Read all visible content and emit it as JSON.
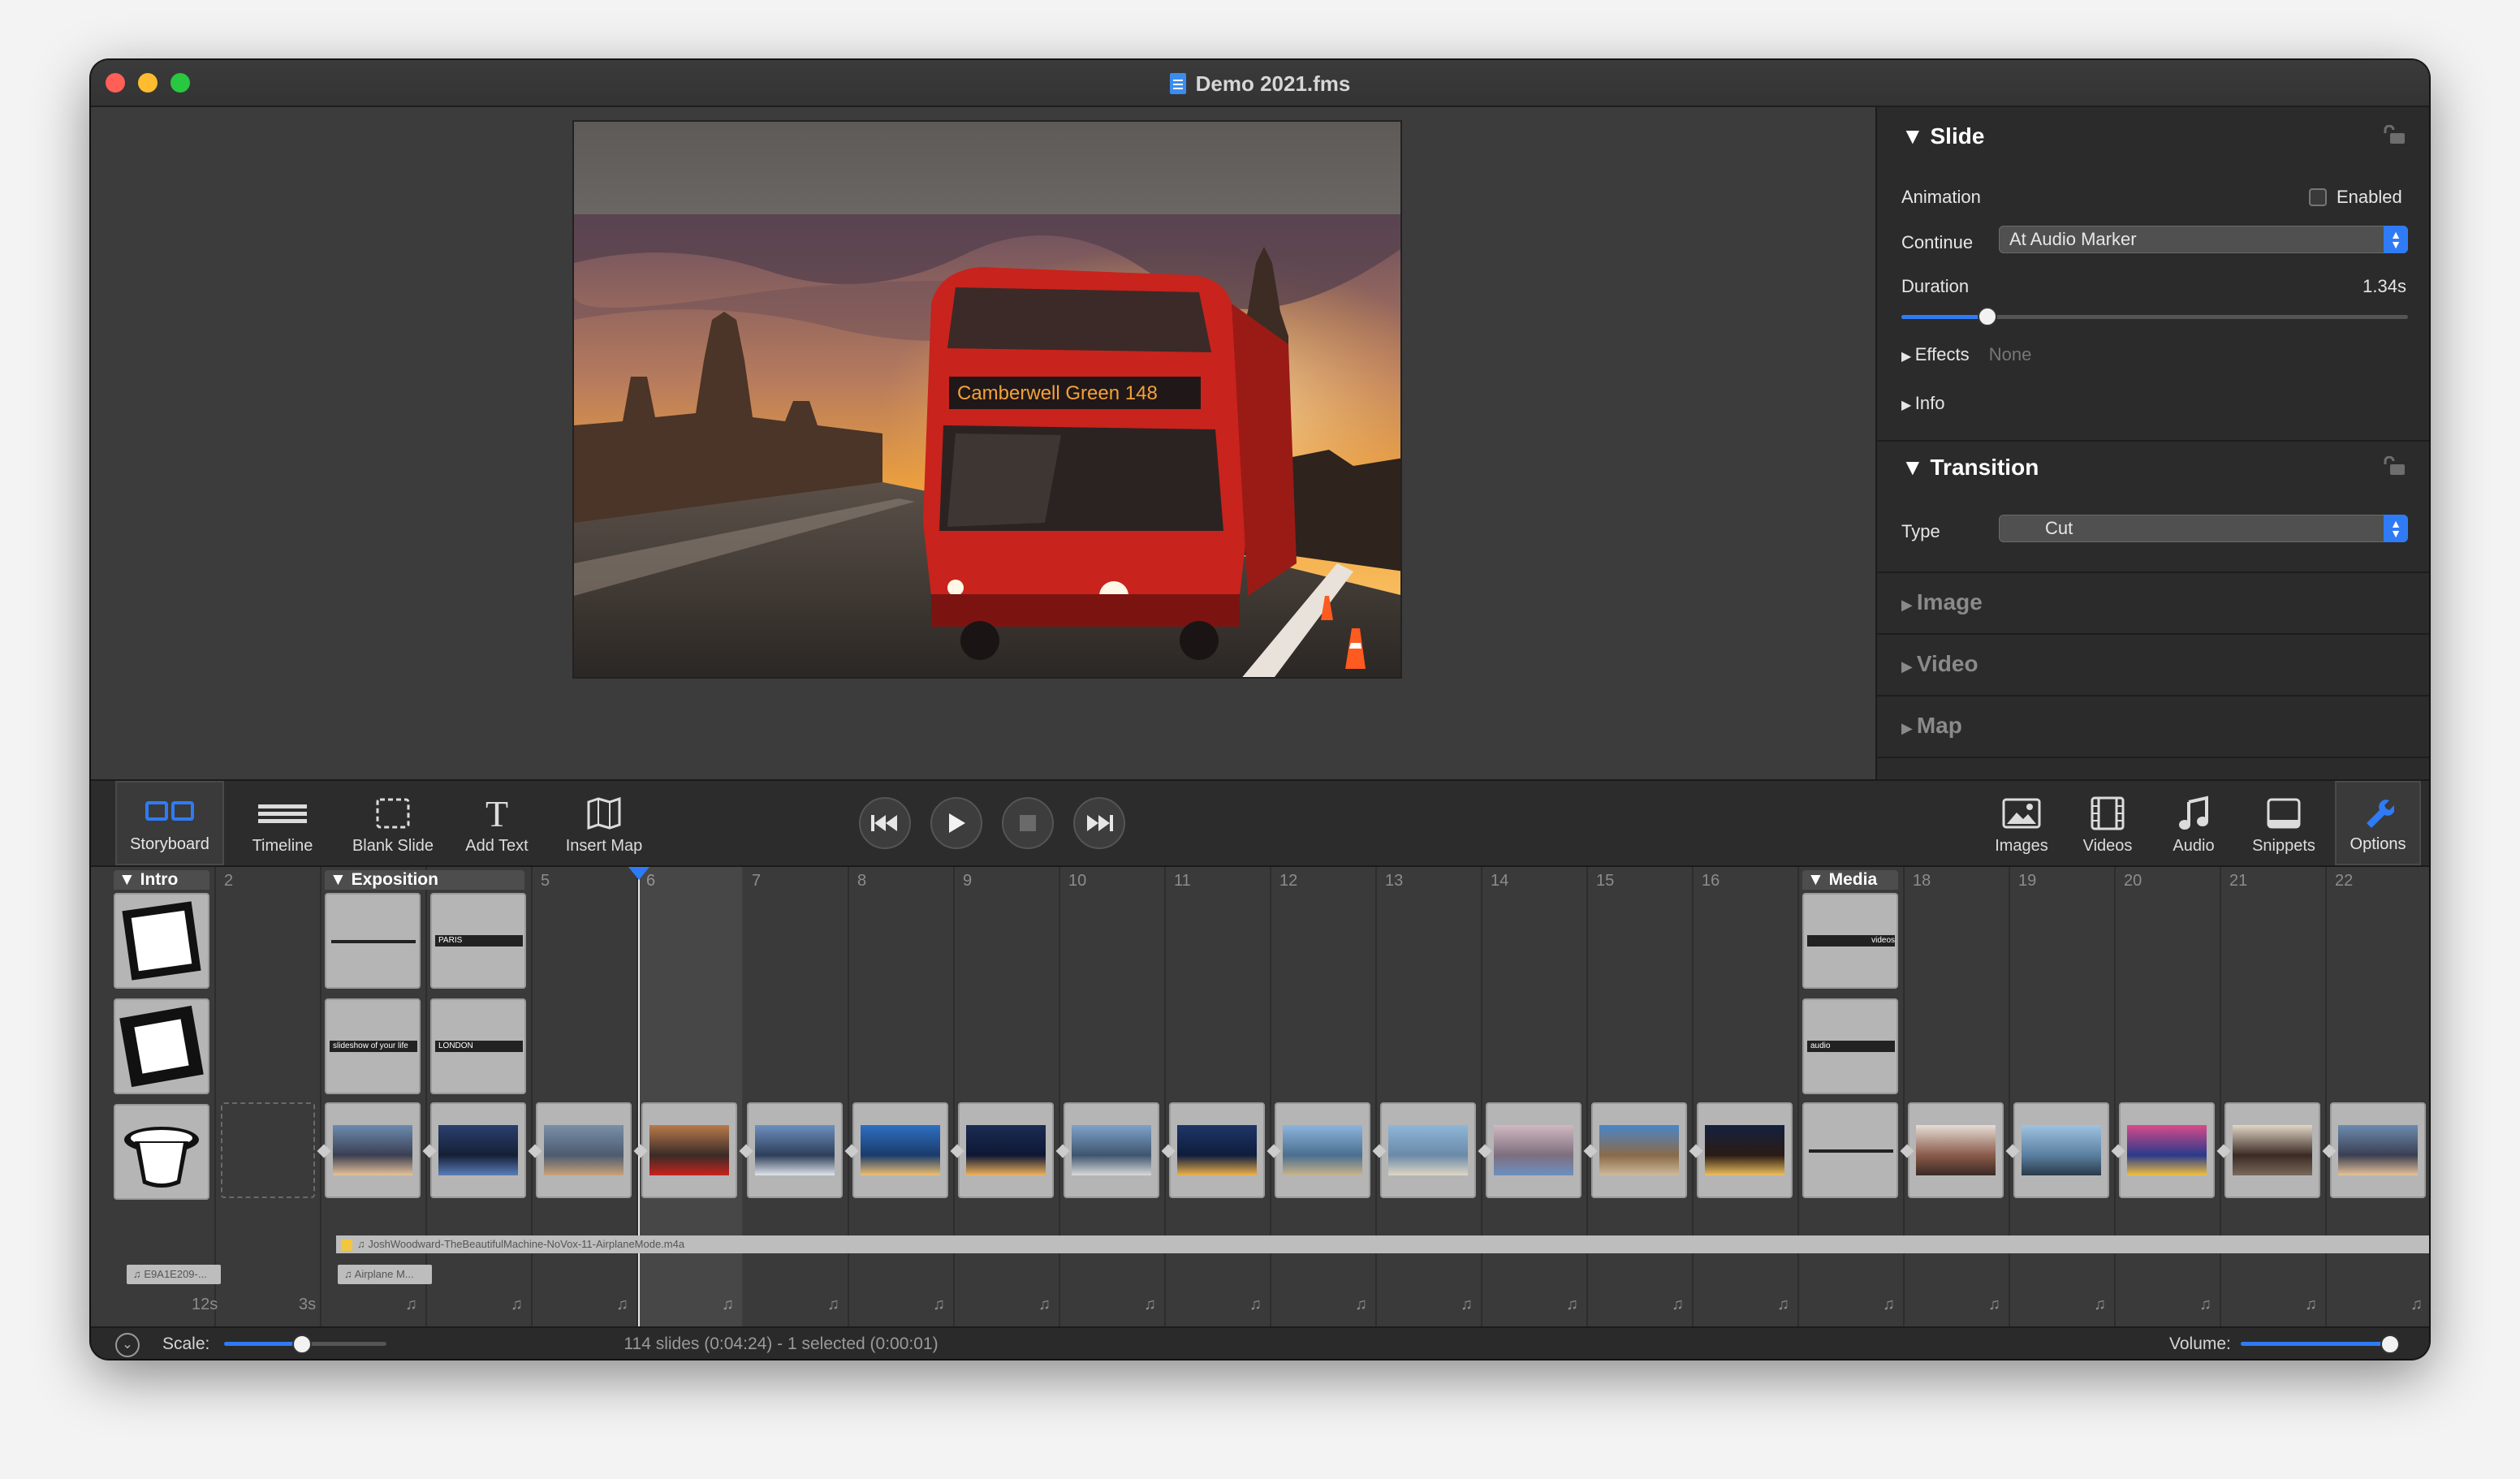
{
  "window": {
    "title": "Demo 2021.fms",
    "traffic_lights": {
      "close": "#ff5f57",
      "minimize": "#febc2e",
      "zoom": "#28c840"
    }
  },
  "inspector": {
    "slide_section": {
      "title": "Slide",
      "animation_label": "Animation",
      "animation_enabled_label": "Enabled",
      "animation_enabled": false,
      "continue_label": "Continue",
      "continue_value": "At Audio Marker",
      "duration_label": "Duration",
      "duration_value": "1.34s",
      "duration_fraction": 0.17,
      "effects_label": "Effects",
      "effects_value": "None",
      "info_label": "Info"
    },
    "transition_section": {
      "title": "Transition",
      "type_label": "Type",
      "type_value": "Cut"
    },
    "collapsed_sections": [
      "Image",
      "Video",
      "Map"
    ]
  },
  "toolbar": {
    "left_tools": [
      {
        "label": "Storyboard",
        "icon": "storyboard-icon",
        "active": true
      },
      {
        "label": "Timeline",
        "icon": "timeline-icon",
        "active": false
      },
      {
        "label": "Blank Slide",
        "icon": "blank-slide-icon",
        "active": false
      },
      {
        "label": "Add Text",
        "icon": "text-icon",
        "active": false
      },
      {
        "label": "Insert Map",
        "icon": "map-icon",
        "active": false
      }
    ],
    "transport": [
      "skip-back-icon",
      "play-icon",
      "stop-icon",
      "skip-forward-icon"
    ],
    "right_tools": [
      {
        "label": "Images",
        "icon": "images-icon"
      },
      {
        "label": "Videos",
        "icon": "videos-icon"
      },
      {
        "label": "Audio",
        "icon": "audio-icon"
      },
      {
        "label": "Snippets",
        "icon": "snippets-icon"
      },
      {
        "label": "Options",
        "icon": "wrench-icon",
        "active": true
      }
    ],
    "accent": "#2f7bf5"
  },
  "timeline": {
    "columns": [
      "1",
      "2",
      "3",
      "4",
      "5",
      "6",
      "7",
      "8",
      "9",
      "10",
      "11",
      "12",
      "13",
      "14",
      "15",
      "16",
      "17",
      "18",
      "19",
      "20",
      "21",
      "22"
    ],
    "groups": [
      {
        "name": "Intro",
        "column": 1
      },
      {
        "name": "Exposition",
        "column": 3
      },
      {
        "name": "Media",
        "column": 17
      }
    ],
    "text_slides": [
      {
        "column": 4,
        "row": 0,
        "text": "PARIS"
      },
      {
        "column": 3,
        "row": 1,
        "text": "slideshow of your life"
      },
      {
        "column": 4,
        "row": 1,
        "text": "LONDON"
      },
      {
        "column": 17,
        "row": 0,
        "text": "videos"
      },
      {
        "column": 17,
        "row": 1,
        "text": "audio"
      }
    ],
    "audio_track": "JoshWoodward-TheBeautifulMachine-NoVox-11-AirplaneMode.m4a",
    "audio_tag_intro": "E9A1E209-...",
    "audio_tag_expo": "Airplane M...",
    "duration_intro": "12s",
    "duration_col2": "3s",
    "selected_column": 6
  },
  "status": {
    "scale_label": "Scale:",
    "scale_fraction": 0.48,
    "summary": "114 slides (0:04:24) - 1 selected (0:00:01)",
    "volume_label": "Volume:",
    "volume_fraction": 1.0
  }
}
